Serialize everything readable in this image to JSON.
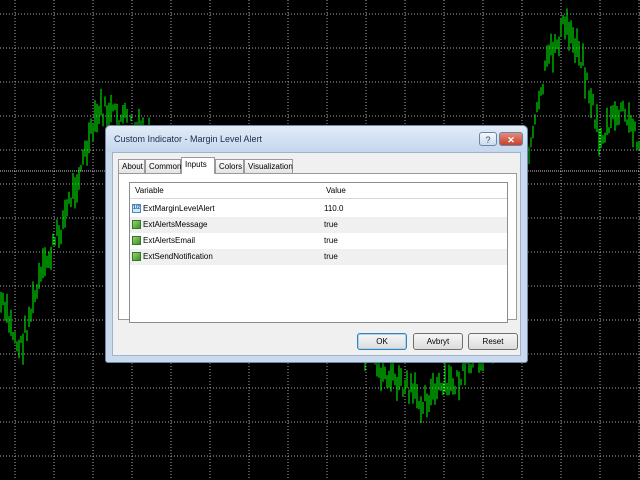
{
  "colors": {
    "background": "#000000",
    "grid": "#aaaaaa",
    "bars": "#00ff00"
  },
  "dialog": {
    "title": "Custom Indicator - Margin Level Alert",
    "help_label": "?",
    "close_label": "✕",
    "tabs": [
      "About",
      "Common",
      "Inputs",
      "Colors",
      "Visualization"
    ],
    "active_tab": "Inputs",
    "table": {
      "headers": [
        "Variable",
        "Value"
      ],
      "rows": [
        {
          "icon": "double-type-icon",
          "icon_text": "1/2",
          "variable": "ExtMarginLevelAlert",
          "value": "110.0"
        },
        {
          "icon": "bool-type-icon",
          "icon_text": "",
          "variable": "ExtAlertsMessage",
          "value": "true"
        },
        {
          "icon": "bool-type-icon",
          "icon_text": "",
          "variable": "ExtAlertsEmail",
          "value": "true"
        },
        {
          "icon": "bool-type-icon",
          "icon_text": "",
          "variable": "ExtSendNotification",
          "value": "true"
        }
      ]
    },
    "buttons": {
      "ok": "OK",
      "cancel": "Avbryt",
      "reset": "Reset"
    }
  }
}
